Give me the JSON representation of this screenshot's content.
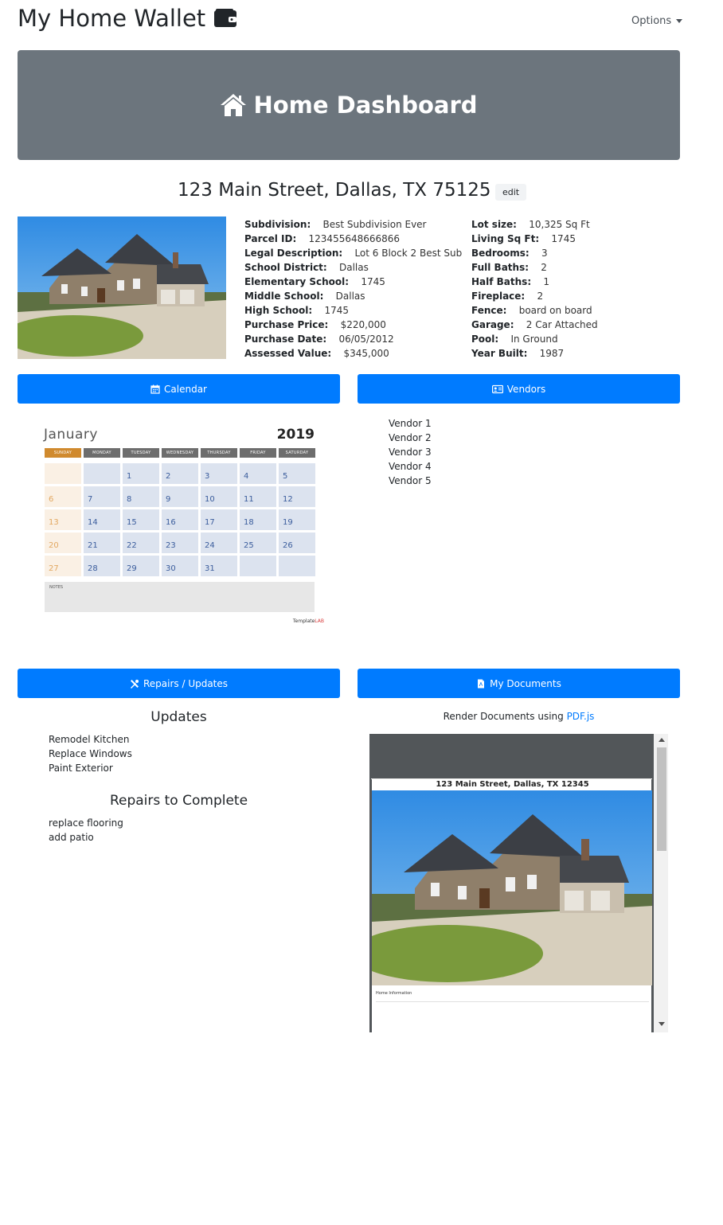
{
  "app": {
    "title": "My Home Wallet",
    "options_label": "Options"
  },
  "hero": {
    "title": "Home Dashboard"
  },
  "home": {
    "address": "123 Main Street, Dallas, TX 75125",
    "edit_label": "edit"
  },
  "details_left": [
    {
      "label": "Subdivision:",
      "value": "Best Subdivision Ever"
    },
    {
      "label": "Parcel ID:",
      "value": "123455648666866"
    },
    {
      "label": "Legal Description:",
      "value": "Lot 6 Block 2 Best Sub"
    },
    {
      "label": "School District:",
      "value": "Dallas"
    },
    {
      "label": "Elementary School:",
      "value": "1745"
    },
    {
      "label": "Middle School:",
      "value": "Dallas"
    },
    {
      "label": "High School:",
      "value": "1745"
    },
    {
      "label": "Purchase Price:",
      "value": "$220,000"
    },
    {
      "label": "Purchase Date:",
      "value": "06/05/2012"
    },
    {
      "label": "Assessed Value:",
      "value": "$345,000"
    }
  ],
  "details_right": [
    {
      "label": "Lot size:",
      "value": "10,325 Sq Ft"
    },
    {
      "label": "Living Sq Ft:",
      "value": "1745"
    },
    {
      "label": "Bedrooms:",
      "value": "3"
    },
    {
      "label": "Full Baths:",
      "value": "2"
    },
    {
      "label": "Half Baths:",
      "value": "1"
    },
    {
      "label": "Fireplace:",
      "value": "2"
    },
    {
      "label": "Fence:",
      "value": "board on board"
    },
    {
      "label": "Garage:",
      "value": "2 Car Attached"
    },
    {
      "label": "Pool:",
      "value": "In Ground"
    },
    {
      "label": "Year Built:",
      "value": "1987"
    }
  ],
  "sections": {
    "calendar": "Calendar",
    "vendors": "Vendors",
    "repairs": "Repairs / Updates",
    "documents": "My Documents"
  },
  "calendar": {
    "month": "January",
    "year": "2019",
    "weekdays": [
      "SUNDAY",
      "MONDAY",
      "TUESDAY",
      "WEDNESDAY",
      "THURSDAY",
      "FRIDAY",
      "SATURDAY"
    ],
    "days": [
      "",
      "",
      "1",
      "2",
      "3",
      "4",
      "5",
      "6",
      "7",
      "8",
      "9",
      "10",
      "11",
      "12",
      "13",
      "14",
      "15",
      "16",
      "17",
      "18",
      "19",
      "20",
      "21",
      "22",
      "23",
      "24",
      "25",
      "26",
      "27",
      "28",
      "29",
      "30",
      "31",
      "",
      ""
    ],
    "notes_label": "NOTES",
    "brand_prefix": "Template",
    "brand_suffix": "LAB"
  },
  "vendors": [
    "Vendor 1",
    "Vendor 2",
    "Vendor 3",
    "Vendor 4",
    "Vendor 5"
  ],
  "updates": {
    "heading": "Updates",
    "items": [
      "Remodel Kitchen",
      "Replace Windows",
      "Paint Exterior"
    ]
  },
  "repairs": {
    "heading": "Repairs to Complete",
    "items": [
      "replace flooring",
      "add patio"
    ]
  },
  "documents": {
    "caption_prefix": "Render Documents using ",
    "caption_link": "PDF.js",
    "pdf_title": "123 Main Street, Dallas, TX 12345",
    "pdf_section": "Home Information"
  },
  "colors": {
    "primary": "#007bff",
    "hero_bg": "#6c757d",
    "pdf_toolbar": "#525659"
  }
}
